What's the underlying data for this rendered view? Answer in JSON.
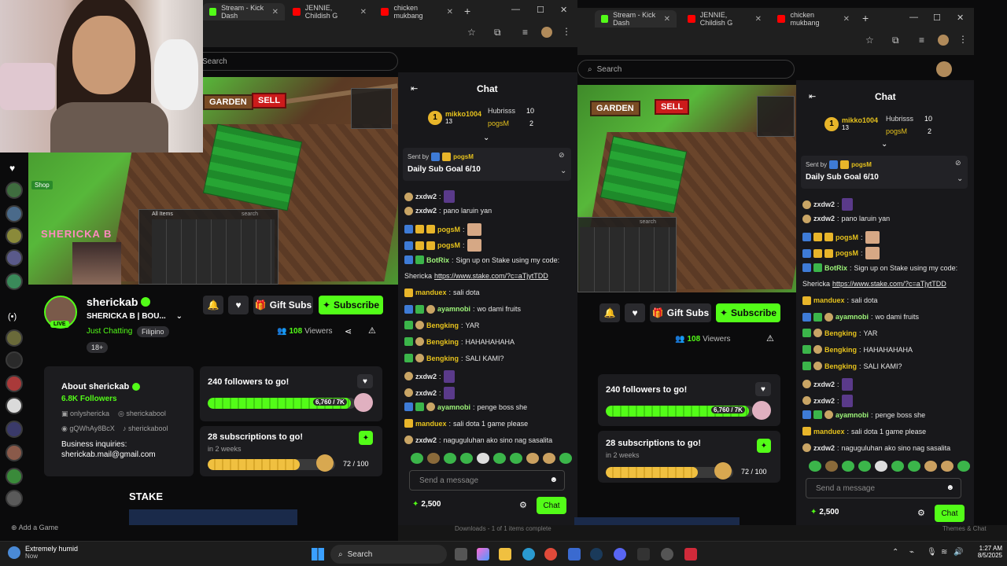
{
  "browser": {
    "tabs": [
      {
        "title": "Stream - Kick Dash",
        "icon": "kick-icon"
      },
      {
        "title": "JENNIE, Childish G",
        "icon": "youtube-icon"
      },
      {
        "title": "chicken mukbang",
        "icon": "youtube-icon"
      }
    ],
    "tabs_right": [
      {
        "title": "Stream - Kick Dash",
        "icon": "kick-icon"
      },
      {
        "title": "JENNIE, Childish G",
        "icon": "youtube-icon"
      },
      {
        "title": "chicken mukbang",
        "icon": "youtube-icon"
      }
    ],
    "new_tab": "+",
    "win_min": "—",
    "win_max": "☐",
    "win_close": "✕"
  },
  "search": {
    "placeholder_left": "Search",
    "placeholder_right": "Search"
  },
  "game": {
    "garden_label": "GARDEN",
    "sell_label": "SELL",
    "shop_label": "Shop",
    "all_items": "All Items",
    "search_small": "search",
    "overlay_name": "SHERICKA B"
  },
  "channel": {
    "name": "sherickab",
    "subtitle": "SHERICKA B | BOU...",
    "category": "Just Chatting",
    "language": "Filipino",
    "age": "18+",
    "live": "LIVE",
    "viewers": "108",
    "viewers_label": "Viewers",
    "gift_subs": "Gift Subs",
    "subscribe": "Subscribe"
  },
  "about": {
    "title": "About sherickab",
    "followers": "6.8K",
    "followers_label": "Followers",
    "facebook": "onlyshericka",
    "instagram": "sherickabool",
    "discord": "gQWhAy8BcX",
    "tiktok": "sherickabool",
    "business_label": "Business inquiries:",
    "business_email": "sherickab.mail@gmail.com"
  },
  "goals": {
    "followers_title": "240 followers to go!",
    "followers_progress": "6,760 / 7K",
    "followers_fraction": 0.966,
    "subs_title": "28 subscriptions to go!",
    "subs_time": "in 2 weeks",
    "subs_progress": "72 / 100",
    "subs_fraction": 0.72
  },
  "stake_label": "STAKE",
  "chat": {
    "title": "Chat",
    "leaders": [
      {
        "name": "mikko1004",
        "count": "13"
      },
      {
        "name": "Hubrisss",
        "count": "10"
      },
      {
        "name": "pogsM",
        "count": "2"
      }
    ],
    "pinned_prefix": "Sent by",
    "pinned_user": "pogsM",
    "pinned_msg": "Daily Sub Goal 6/10",
    "messages": [
      {
        "user": "zxdw2",
        "text": ""
      },
      {
        "user": "zxdw2",
        "text": "pano laruin yan"
      },
      {
        "user": "pogsM",
        "text": ""
      },
      {
        "user": "pogsM",
        "text": ""
      },
      {
        "user": "BotRix",
        "text": "Sign up on Stake using my code:"
      },
      {
        "user": "",
        "text": "Shericka https://www.stake.com/?c=aTjytTDD"
      },
      {
        "user": "manduex",
        "text": "sali dota"
      },
      {
        "user": "ayamnobi",
        "text": "wo dami fruits"
      },
      {
        "user": "Bengking",
        "text": "YAR"
      },
      {
        "user": "Bengking",
        "text": "HAHAHAHAHA"
      },
      {
        "user": "Bengking",
        "text": "SALI KAMI?"
      },
      {
        "user": "zxdw2",
        "text": ""
      },
      {
        "user": "zxdw2",
        "text": ""
      },
      {
        "user": "ayamnobi",
        "text": "penge boss she"
      },
      {
        "user": "manduex",
        "text": "sali dota 1 game please"
      },
      {
        "user": "zxdw2",
        "text": "naguguluhan ako sino nag sasalita"
      }
    ],
    "bot_code_prefix": "Shericka",
    "bot_link": "https://www.stake.com/?c=aTjytTDD",
    "input_placeholder": "Send a message",
    "points": "2,500",
    "send_button": "Chat"
  },
  "left_bottom": {
    "add_game": "Add a Game"
  },
  "download_bar": {
    "text": "Downloads - 1 of 1 items complete"
  },
  "themes_chat": "Themes & Chat",
  "taskbar": {
    "weather_title": "Extremely humid",
    "weather_sub": "Now",
    "search": "Search",
    "time": "1:27 AM",
    "date": "8/5/2025"
  }
}
